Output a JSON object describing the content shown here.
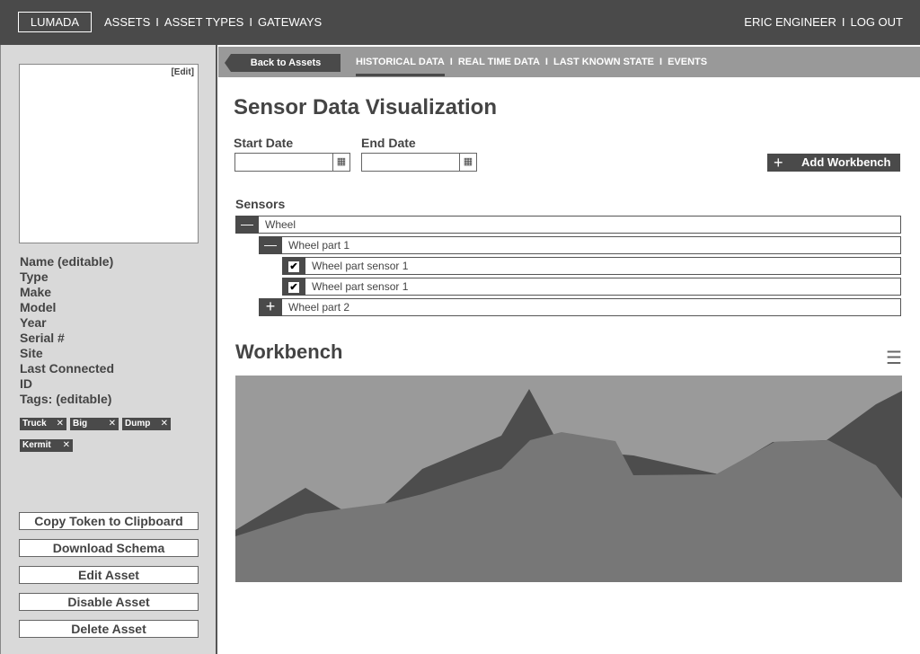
{
  "topbar": {
    "logo": "LUMADA",
    "nav": [
      "ASSETS",
      "ASSET TYPES",
      "GATEWAYS"
    ],
    "user": "ERIC ENGINEER",
    "logout": "LOG OUT"
  },
  "sidebar": {
    "edit": "[Edit]",
    "fields": [
      "Name (editable)",
      "Type",
      "Make",
      "Model",
      "Year",
      "Serial #",
      "Site",
      "Last Connected",
      "ID",
      "Tags: (editable)"
    ],
    "tags": [
      "Truck",
      "Big",
      "Dump",
      "Kermit"
    ],
    "buttons": [
      "Copy Token to Clipboard",
      "Download Schema",
      "Edit Asset",
      "Disable Asset",
      "Delete Asset"
    ]
  },
  "subnav": {
    "back": "Back to Assets",
    "tabs": [
      "HISTORICAL DATA",
      "REAL TIME DATA",
      "LAST KNOWN STATE",
      "EVENTS"
    ],
    "active": "HISTORICAL DATA"
  },
  "main": {
    "title": "Sensor Data Visualization",
    "start_label": "Start Date",
    "start_value": "",
    "end_label": "End Date",
    "end_value": "",
    "add_workbench": "Add Workbench",
    "sensors_label": "Sensors",
    "tree": [
      {
        "label": "Wheel",
        "state": "expanded"
      },
      {
        "label": "Wheel part 1",
        "state": "expanded"
      },
      {
        "label": "Wheel part sensor 1",
        "checked": true
      },
      {
        "label": "Wheel part sensor 1",
        "checked": true
      },
      {
        "label": "Wheel part 2",
        "state": "collapsed"
      }
    ],
    "workbench_title": "Workbench"
  },
  "colors": {
    "dark": "#4a4a4a",
    "chart_bg": "#9a9a9a",
    "series_dark": "#4d4d4d",
    "series_light": "#777777"
  }
}
